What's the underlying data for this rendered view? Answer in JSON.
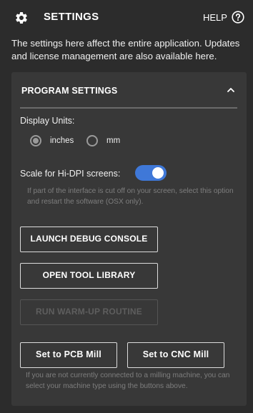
{
  "header": {
    "title": "SETTINGS",
    "help_label": "HELP"
  },
  "intro_text": "The settings here affect the entire application. Updates and license management are also available here.",
  "panel": {
    "title": "PROGRAM SETTINGS",
    "display_units_label": "Display Units:",
    "units": [
      {
        "label": "inches",
        "selected": true
      },
      {
        "label": "mm",
        "selected": false
      }
    ],
    "scale_label": "Scale for Hi-DPI screens:",
    "scale_enabled": true,
    "scale_hint": "If part of the interface is cut off on your screen, select this option and restart the software (OSX only).",
    "buttons": {
      "debug": "LAUNCH DEBUG CONSOLE",
      "tool_library": "OPEN TOOL LIBRARY",
      "warmup": "RUN WARM-UP ROUTINE"
    },
    "machine_buttons": {
      "pcb": "Set to PCB Mill",
      "cnc": "Set to CNC Mill"
    },
    "machine_hint": "If you are not currently connected to a milling machine, you can select your machine type using the buttons above."
  },
  "colors": {
    "background": "#2c2c2c",
    "panel": "#383838",
    "toggle_on": "#3f78d8",
    "hint_text": "#7e7e7e"
  },
  "icons": {
    "settings": "gear-icon",
    "help": "question-circle-icon",
    "collapse": "chevron-up-icon"
  }
}
